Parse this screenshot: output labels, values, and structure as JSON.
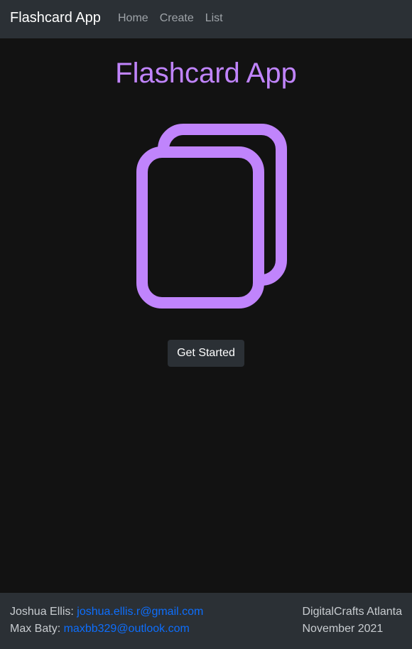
{
  "navbar": {
    "brand": "Flashcard App",
    "links": [
      "Home",
      "Create",
      "List"
    ]
  },
  "main": {
    "title": "Flashcard App",
    "logo_icon": "flashcards-icon",
    "cta_label": "Get Started"
  },
  "footer": {
    "authors": [
      {
        "name": "Joshua Ellis:",
        "email": "joshua.ellis.r@gmail.com"
      },
      {
        "name": "Max Baty:",
        "email": "maxbb329@outlook.com"
      }
    ],
    "org": "DigitalCrafts Atlanta",
    "date": "November 2021"
  },
  "colors": {
    "accent": "#c084fc",
    "background": "#121212",
    "bar": "#2b3035",
    "link": "#0d6efd"
  }
}
